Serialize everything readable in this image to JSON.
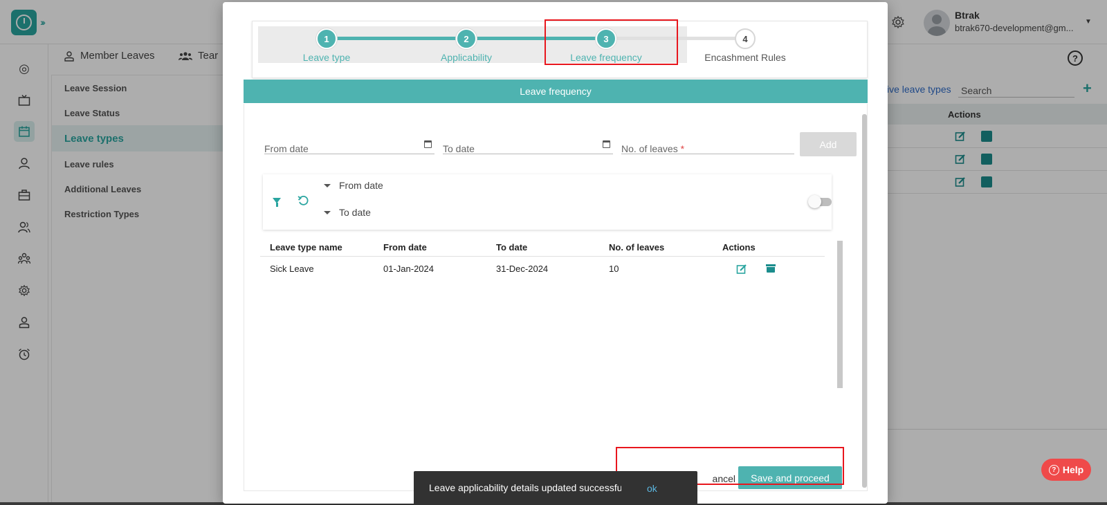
{
  "user": {
    "name": "Btrak",
    "email": "btrak670-development@gm..."
  },
  "subnav": {
    "member_leaves": "Member Leaves",
    "team": "Tear"
  },
  "left_menu": [
    {
      "label": "Leave Session",
      "active": false
    },
    {
      "label": "Leave Status",
      "active": false
    },
    {
      "label": "Leave types",
      "active": true
    },
    {
      "label": "Leave rules",
      "active": false
    },
    {
      "label": "Additional Leaves",
      "active": false
    },
    {
      "label": "Restriction Types",
      "active": false
    }
  ],
  "right_panel": {
    "help_glyph": "?",
    "archive_link": "ive leave types",
    "search_placeholder": "Search",
    "plus": "+",
    "actions_header": "Actions"
  },
  "help_button": {
    "label": "Help"
  },
  "stepper": {
    "steps": [
      {
        "num": "1",
        "label": "Leave type",
        "state": "done"
      },
      {
        "num": "2",
        "label": "Applicability",
        "state": "done"
      },
      {
        "num": "3",
        "label": "Leave frequency",
        "state": "active"
      },
      {
        "num": "4",
        "label": "Encashment Rules",
        "state": "pending"
      }
    ]
  },
  "section_title": "Leave frequency",
  "form": {
    "from_date": "From date",
    "to_date": "To date",
    "no_of_leaves": "No. of leaves",
    "required_mark": "*",
    "add_label": "Add"
  },
  "filter": {
    "from_date": "From date",
    "to_date": "To date"
  },
  "table": {
    "headers": [
      "Leave type name",
      "From date",
      "To date",
      "No. of leaves",
      "Actions"
    ],
    "rows": [
      {
        "name": "Sick Leave",
        "from": "01-Jan-2024",
        "to": "31-Dec-2024",
        "count": "10"
      }
    ]
  },
  "footer": {
    "cancel": "ancel",
    "save": "Save and proceed"
  },
  "snackbar": {
    "message": "Leave applicability details updated successfully",
    "ok": "ok"
  },
  "colors": {
    "teal": "#4eb3b0",
    "highlight": "#e8161d",
    "snackbar": "#323232",
    "help": "#ef4a4a"
  }
}
